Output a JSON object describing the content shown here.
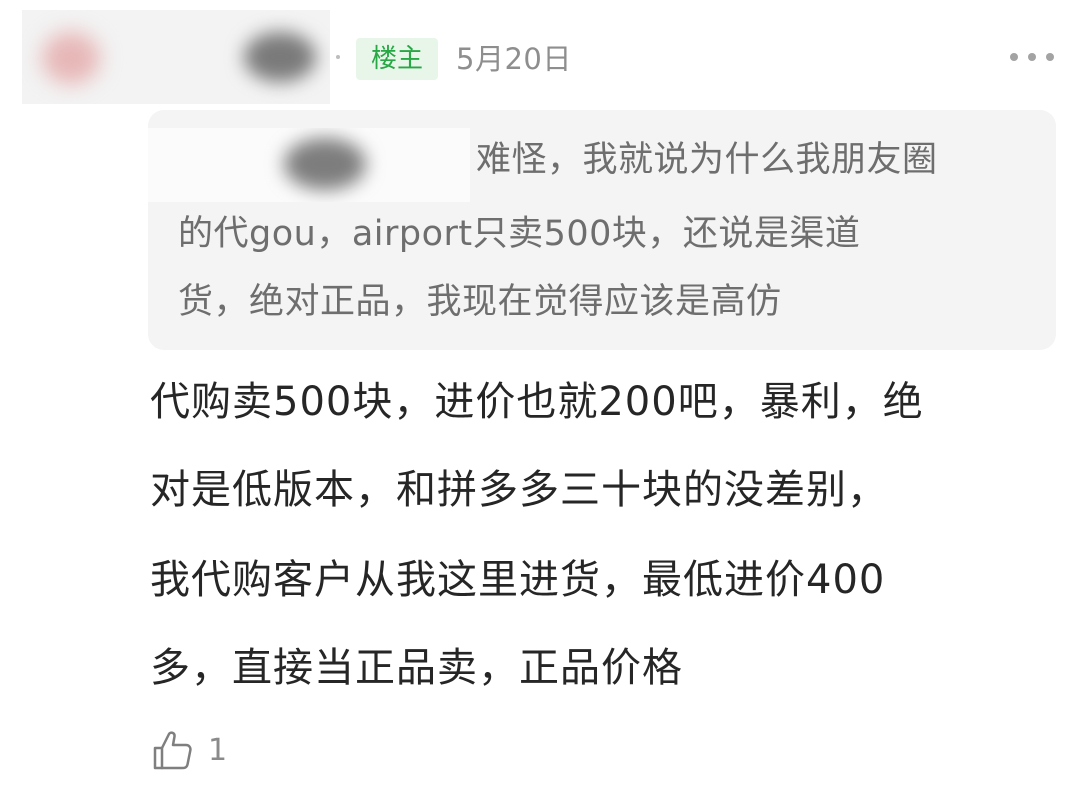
{
  "comment": {
    "author_badge": "楼主",
    "date": "5月20日",
    "quoted_reply": {
      "lines": [
        "难怪，我就说为什么我朋友圈",
        "的代gou，airport只卖500块，还说是渠道",
        "货，绝对正品，我现在觉得应该是高仿"
      ]
    },
    "body_lines": [
      "代购卖500块，进价也就200吧，暴利，绝",
      "对是低版本，和拼多多三十块的没差别，",
      "我代购客户从我这里进货，最低进价400",
      "多，直接当正品卖，正品价格"
    ],
    "likes": "1"
  },
  "colors": {
    "badge_green": "#28a745",
    "badge_bg": "#e8f6ea",
    "quote_bg": "#f4f4f4",
    "meta_gray": "#8e8e8e"
  },
  "icons": [
    "more-icon",
    "thumbs-up-icon"
  ]
}
